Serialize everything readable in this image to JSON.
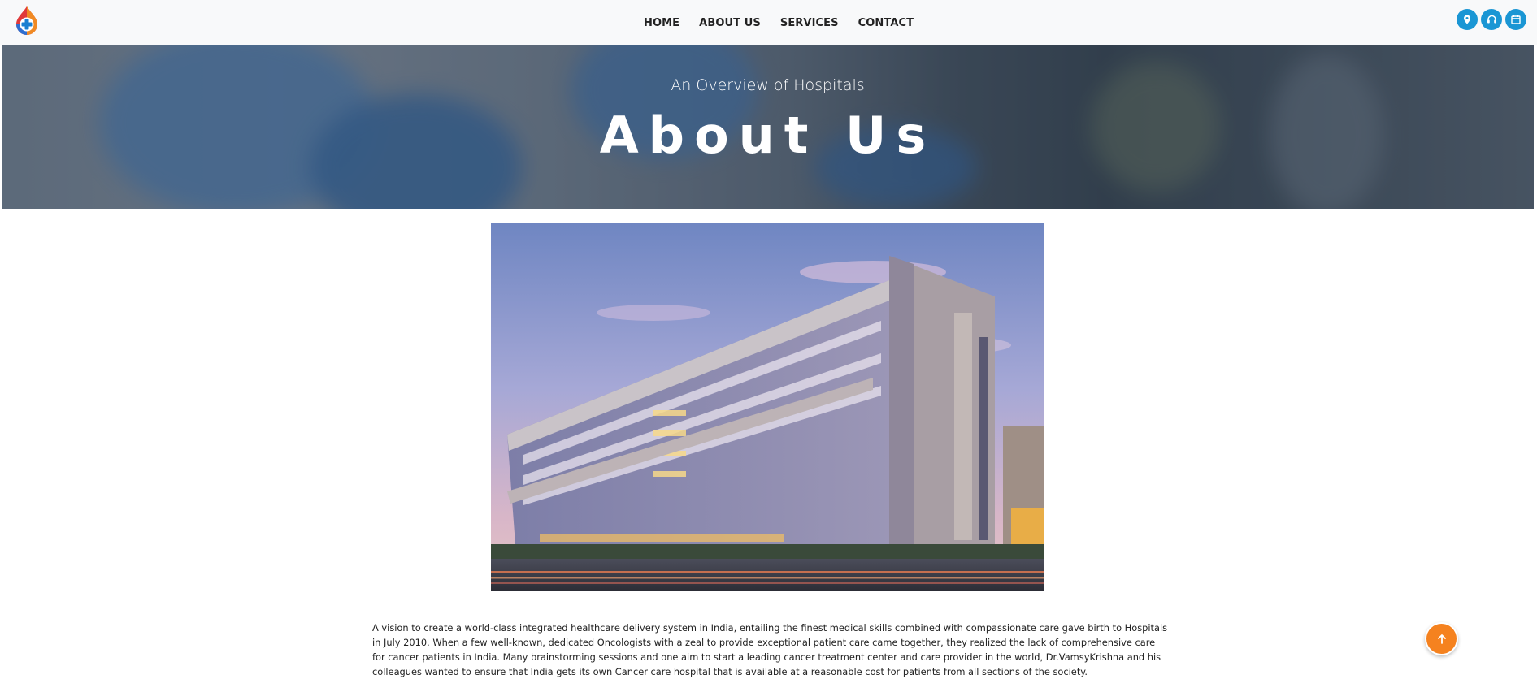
{
  "nav": {
    "logo_icon": "hospital-drop-plus-logo",
    "links": [
      "HOME",
      "ABOUT US",
      "SERVICES",
      "CONTACT"
    ],
    "icons": [
      "map-pin-icon",
      "headset-icon",
      "calendar-icon"
    ],
    "accent_color": "#1a96d4"
  },
  "hero": {
    "subtitle": "An Overview of Hospitals",
    "title": "About Us"
  },
  "about": {
    "paragraph": "A vision to create a world-class integrated healthcare delivery system in India, entailing the finest medical skills combined with compassionate care gave birth to Hospitals in July 2010. When a few well-known, dedicated Oncologists with a zeal to provide exceptional patient care came together, they realized the lack of comprehensive care for cancer patients in India. Many brainstorming sessions and one aim to start a leading cancer treatment center and care provider in the world, Dr.VamsyKrishna and his colleagues wanted to ensure that India gets its own Cancer care hospital that is available at a reasonable cost for patients from all sections of the society."
  },
  "scroll_top": {
    "icon": "arrow-up-icon",
    "color": "#f5821f"
  }
}
